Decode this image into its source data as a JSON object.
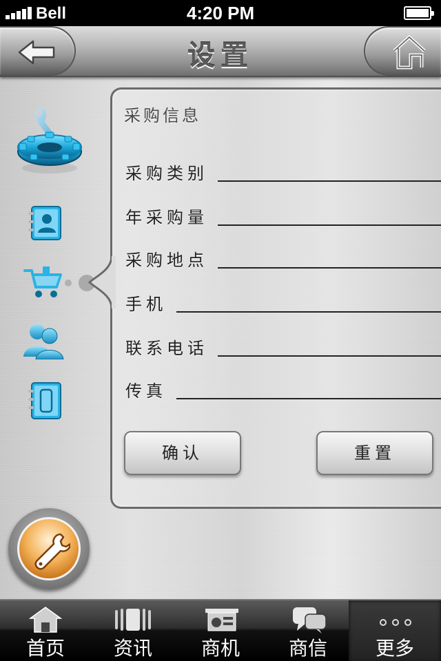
{
  "status_bar": {
    "carrier": "Bell",
    "time": "4:20 PM"
  },
  "header": {
    "title": "设置",
    "back_icon": "back-arrow-icon",
    "home_icon": "home-icon"
  },
  "sidebar": {
    "items": [
      {
        "icon": "gear-wrench-icon"
      },
      {
        "icon": "contact-card-icon"
      },
      {
        "icon": "shopping-cart-icon"
      },
      {
        "icon": "users-icon"
      },
      {
        "icon": "mobile-phone-icon"
      }
    ]
  },
  "form": {
    "section_title": "采购信息",
    "fields": [
      {
        "label": "采购类别",
        "value": ""
      },
      {
        "label": "年采购量",
        "value": ""
      },
      {
        "label": "采购地点",
        "value": ""
      },
      {
        "label": "手机",
        "value": ""
      },
      {
        "label": "联系电话",
        "value": ""
      },
      {
        "label": "传真",
        "value": ""
      }
    ],
    "confirm_label": "确认",
    "reset_label": "重置"
  },
  "tab_bar": {
    "tabs": [
      {
        "label": "首页",
        "icon": "house-icon"
      },
      {
        "label": "资讯",
        "icon": "news-icon"
      },
      {
        "label": "商机",
        "icon": "presentation-icon"
      },
      {
        "label": "商信",
        "icon": "chat-icon"
      },
      {
        "label": "更多",
        "icon": "more-dots-icon",
        "active": true
      }
    ]
  },
  "colors": {
    "accent_blue": "#1aa6d8",
    "tool_orange": "#e8922e"
  }
}
